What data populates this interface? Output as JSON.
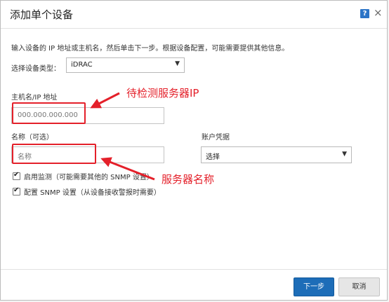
{
  "dialog": {
    "title": "添加单个设备",
    "help_label": "?",
    "close_label": "×",
    "description": "输入设备的 IP 地址或主机名，然后单击下一步。根据设备配置，可能需要提供其他信息。",
    "device_type": {
      "label": "选择设备类型：",
      "value": "iDRAC",
      "arrow": "▼"
    },
    "hostname": {
      "label": "主机名/IP 地址",
      "placeholder": "000.000.000.000"
    },
    "name": {
      "label": "名称（可选）",
      "placeholder": "名称"
    },
    "credentials": {
      "label": "账户凭据",
      "value": "选择",
      "arrow": "▼"
    },
    "checkboxes": [
      {
        "label": "启用监测（可能需要其他的 SNMP 设置）",
        "checked": true,
        "tick": "✔"
      },
      {
        "label": "配置 SNMP 设置（从设备接收警报时需要）",
        "checked": true,
        "tick": "✔"
      }
    ],
    "buttons": {
      "next": "下一步",
      "cancel": "取消"
    }
  },
  "annotations": {
    "server_ip": "待检测服务器IP",
    "server_name": "服务器名称",
    "color": "#e4202a"
  }
}
